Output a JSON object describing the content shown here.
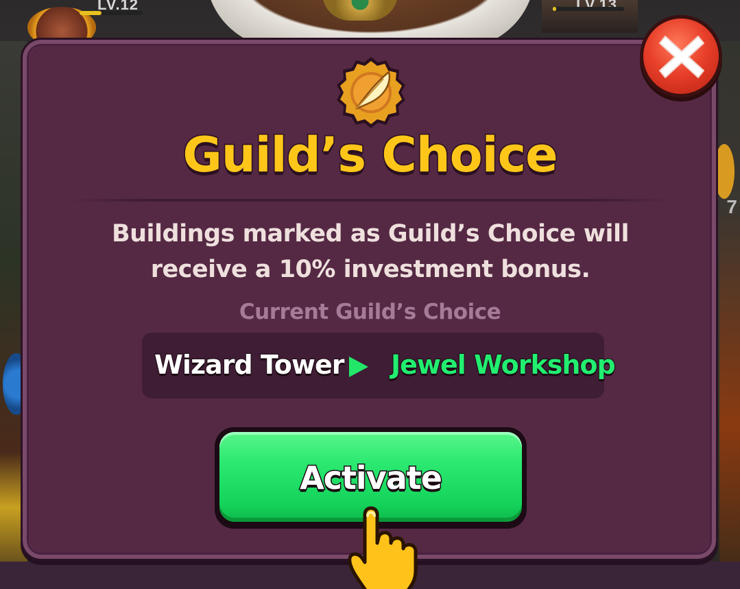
{
  "background": {
    "level_left": "LV.12",
    "level_right": "LV.13",
    "side_number": "7"
  },
  "modal": {
    "title": "Guild’s Choice",
    "description": "Buildings marked as Guild’s Choice will receive a 10% investment bonus.",
    "current_label": "Current Guild’s Choice",
    "choice_from": "Wizard Tower",
    "choice_to": "Jewel Workshop",
    "activate_label": "Activate",
    "close_icon": "close-icon",
    "medal_icon": "quill-medal-icon",
    "arrow_icon": "play-arrow-icon",
    "hand_icon": "pointing-hand-icon"
  },
  "colors": {
    "title": "#ffc61a",
    "modal_bg": "#552944",
    "choice_to": "#22ee70",
    "button_green": "#2ae870",
    "close_red": "#e8402a"
  }
}
